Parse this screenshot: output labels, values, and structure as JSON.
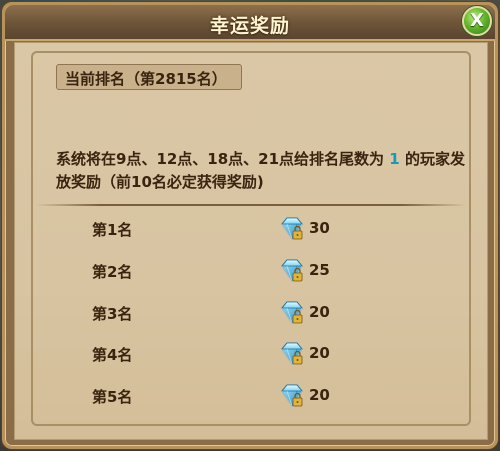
{
  "dialog": {
    "title": "幸运奖励",
    "close_label": "X",
    "rank_label": "当前排名（第2815名）",
    "notice": {
      "before": "系统将在9点、12点、18点、21点给排名尾数为 ",
      "highlight": "1",
      "after": " 的玩家发放奖励（前10名必定获得奖励)"
    },
    "rewards": [
      {
        "place": "第1名",
        "icon": "diamond-icon",
        "amount": "30"
      },
      {
        "place": "第2名",
        "icon": "diamond-icon",
        "amount": "25"
      },
      {
        "place": "第3名",
        "icon": "diamond-icon",
        "amount": "20"
      },
      {
        "place": "第4名",
        "icon": "diamond-icon",
        "amount": "20"
      },
      {
        "place": "第5名",
        "icon": "diamond-icon",
        "amount": "20"
      }
    ]
  },
  "colors": {
    "frame": "#b8925b",
    "parchment": "#d8c4a1",
    "text": "#3a2410",
    "highlight": "#1a9bb5",
    "close_button": "#63b62e"
  }
}
